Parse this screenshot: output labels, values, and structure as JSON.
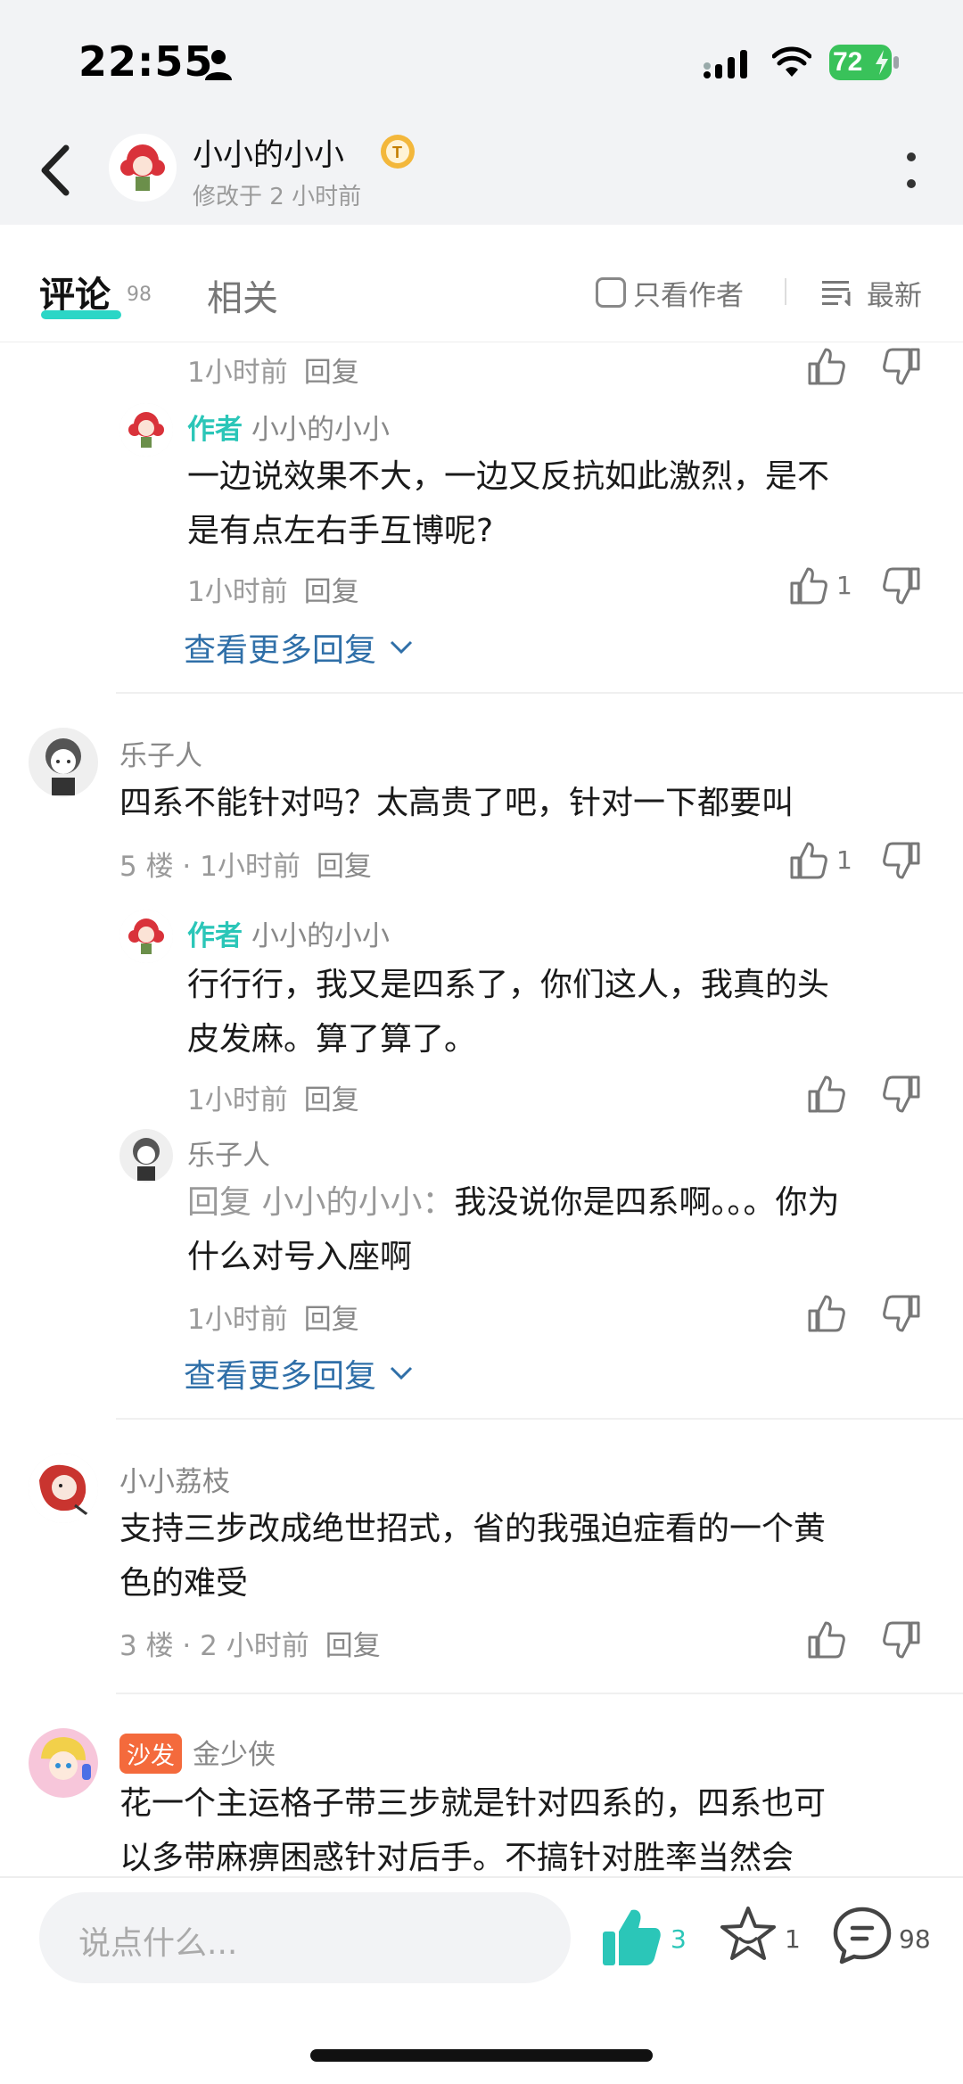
{
  "status_bar": {
    "time": "22:55",
    "battery": "72"
  },
  "header": {
    "title": "小小的小小",
    "subtitle": "修改于 2 小时前"
  },
  "tabs": {
    "comments_label": "评论",
    "comments_count": "98",
    "related_label": "相关",
    "only_author_label": "只看作者",
    "sort_label": "最新"
  },
  "labels": {
    "reply": "回复",
    "author_tag": "作者",
    "more_replies": "查看更多回复",
    "sofa": "沙发"
  },
  "comments": {
    "c0": {
      "meta_time": "1小时前"
    },
    "c0r1": {
      "name": "小小的小小",
      "text1": "一边说效果不大，一边又反抗如此激烈，是不",
      "text2": "是有点左右手互博呢?",
      "time": "1小时前",
      "likes": "1"
    },
    "c1": {
      "name": "乐子人",
      "text": "四系不能针对吗？太高贵了吧，针对一下都要叫",
      "meta": "5 楼 · 1小时前",
      "likes": "1"
    },
    "c1r1": {
      "name": "小小的小小",
      "text1": "行行行，我又是四系了，你们这人，我真的头",
      "text2": "皮发麻。算了算了。",
      "time": "1小时前"
    },
    "c1r2": {
      "name": "乐子人",
      "reply_prefix": "回复 小小的小小：",
      "text1": "我没说你是四系啊。。。你为",
      "text2": "什么对号入座啊",
      "time": "1小时前"
    },
    "c2": {
      "name": "小小荔枝",
      "text1": "支持三步改成绝世招式，省的我强迫症看的一个黄",
      "text2": "色的难受",
      "meta": "3 楼 · 2 小时前"
    },
    "c3": {
      "name": "金少侠",
      "text1": "花一个主运格子带三步就是针对四系的，四系也可",
      "text2": "以多带麻痹困惑针对后手。不搞针对胜率当然会"
    }
  },
  "bottom_bar": {
    "placeholder": "说点什么...",
    "like_count": "3",
    "fav_count": "1",
    "comment_count": "98"
  },
  "colors": {
    "accent": "#2bc6b8",
    "link": "#2f6fa8",
    "sofa": "#f46a3c",
    "battery": "#39c25a"
  },
  "icons": [
    "back-arrow-icon",
    "more-dots-icon",
    "thumb-up-icon",
    "thumb-down-icon",
    "chevron-down-icon",
    "star-icon",
    "chat-bubble-icon",
    "sort-list-icon",
    "checkbox-icon",
    "level-badge-icon"
  ]
}
